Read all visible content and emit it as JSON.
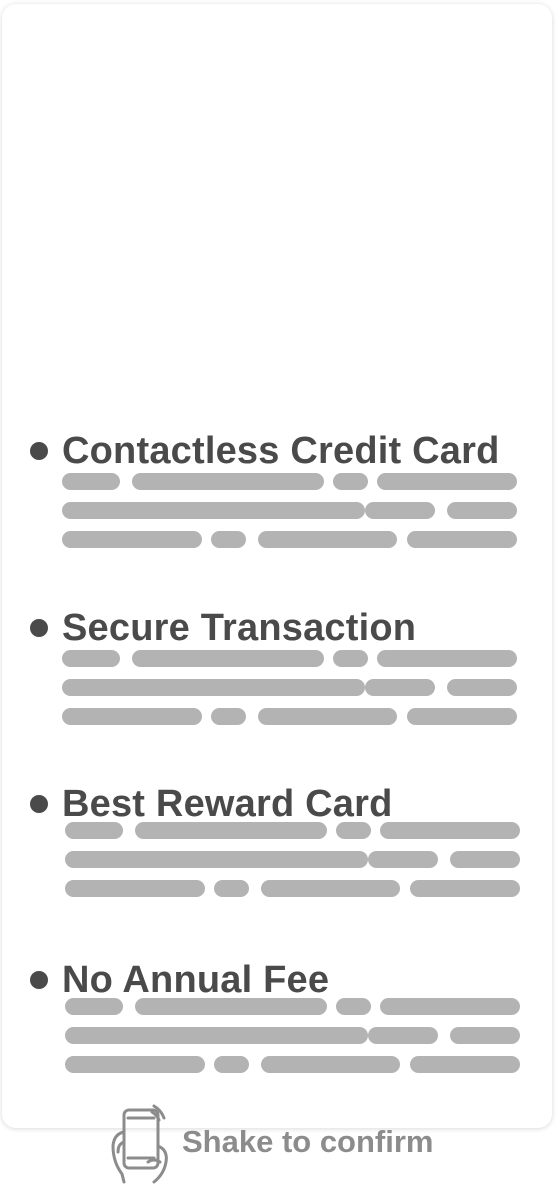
{
  "features": [
    {
      "title": "Contactless Credit Card"
    },
    {
      "title": "Secure Transaction"
    },
    {
      "title": "Best Reward Card"
    },
    {
      "title": "No Annual Fee"
    }
  ],
  "footer": {
    "icon": "shake-phone-icon",
    "label": "Shake to confirm"
  },
  "colors": {
    "text": "#4a4a4a",
    "placeholder": "#b3b3b3",
    "footer_text": "#8c8c8c"
  }
}
